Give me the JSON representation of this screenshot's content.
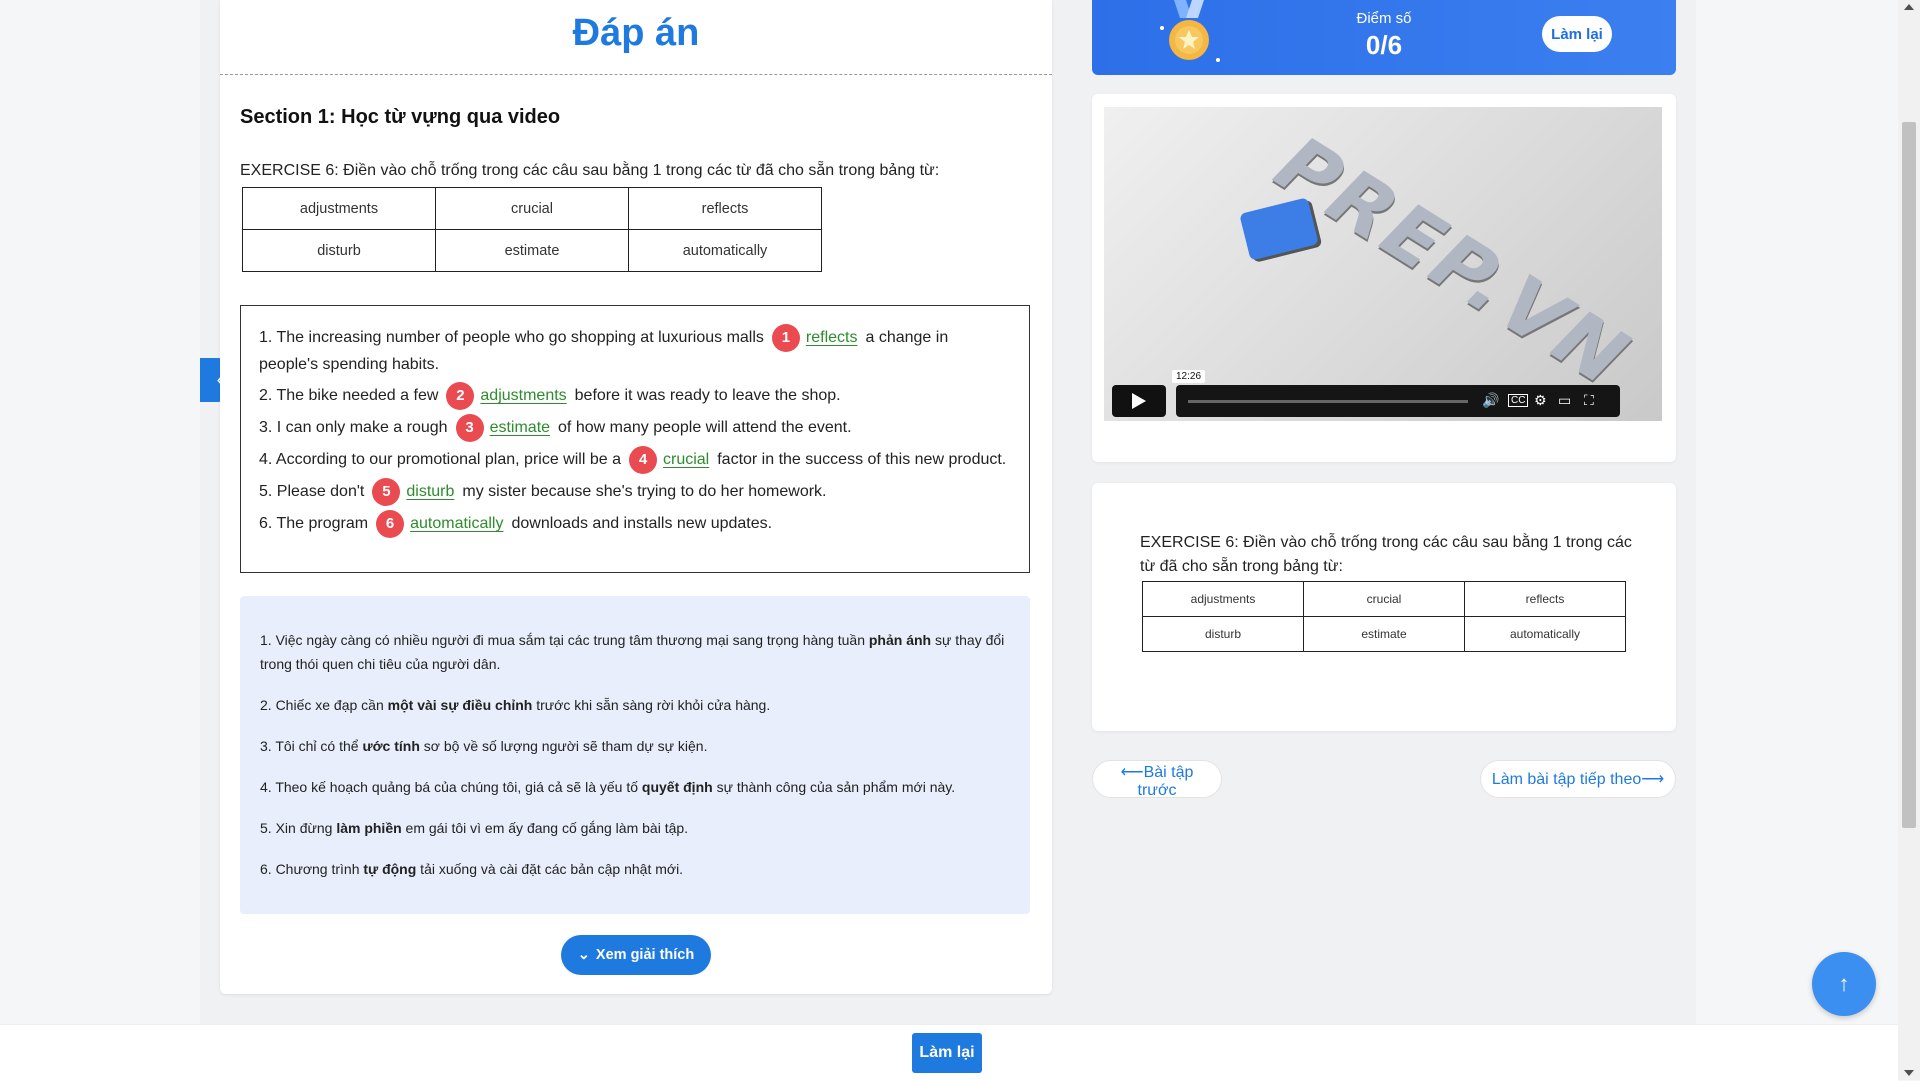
{
  "header": {
    "title": "Đáp án"
  },
  "section": {
    "title": "Section 1: Học từ vựng qua video"
  },
  "exercise": {
    "intro": "EXERCISE 6: Điền vào chỗ trống trong các câu sau bằng 1 trong các từ đã cho sẵn trong bảng từ:",
    "words": [
      [
        "adjustments",
        "crucial",
        "reflects"
      ],
      [
        "disturb",
        "estimate",
        "automatically"
      ]
    ]
  },
  "questions": [
    {
      "num": "1",
      "before": "1. The increasing number of people who go shopping at luxurious malls",
      "answer": "reflects",
      "after": "a change in people's spending habits."
    },
    {
      "num": "2",
      "before": "2. The bike needed a few",
      "answer": "adjustments",
      "after": "before it was ready to leave the shop."
    },
    {
      "num": "3",
      "before": "3. I can only make a rough",
      "answer": "estimate",
      "after": "of how many people will attend the event."
    },
    {
      "num": "4",
      "before": "4. According to our promotional plan, price will be a",
      "answer": "crucial",
      "after": "factor in the success of this new product."
    },
    {
      "num": "5",
      "before": "5. Please don't",
      "answer": "disturb",
      "after": "my sister because she's trying to do her homework."
    },
    {
      "num": "6",
      "before": "6. The program",
      "answer": "automatically",
      "after": "downloads and installs new updates."
    }
  ],
  "translations": [
    {
      "before": "1. Việc ngày càng có nhiều người đi mua sắm tại các trung tâm thương mại sang trọng hàng tuần ",
      "bold": "phản ánh",
      "after": " sự thay đổi trong thói quen chi tiêu của người dân."
    },
    {
      "before": "2. Chiếc xe đạp cần ",
      "bold": "một vài sự điều chỉnh",
      "after": " trước khi sẵn sàng rời khỏi cửa hàng."
    },
    {
      "before": "3. Tôi chỉ có thể ",
      "bold": "ước tính",
      "after": " sơ bộ về số lượng người sẽ tham dự sự kiện."
    },
    {
      "before": "4. Theo kế hoạch quảng bá của chúng tôi, giá cả sẽ là yếu tố ",
      "bold": "quyết định",
      "after": " sự thành công của sản phẩm mới này."
    },
    {
      "before": "5. Xin đừng ",
      "bold": "làm phiền",
      "after": " em gái tôi vì em ấy đang cố gắng làm bài tập."
    },
    {
      "before": "6. Chương trình ",
      "bold": "tự động",
      "after": " tải xuống và cài đặt các bản cập nhật mới."
    }
  ],
  "buttons": {
    "explain": "Xem giải thích",
    "retry": "Làm lại",
    "prev_exercise": "⟵Bài tập trước",
    "next_exercise": "Làm bài tập tiếp theo⟶"
  },
  "score": {
    "label": "Điểm số",
    "value": "0/6"
  },
  "video": {
    "time": "12:26",
    "logo": "PREP.VN"
  },
  "colors": {
    "primary": "#1f7ae0",
    "badge": "#e94b50",
    "answer": "#2e8b2e",
    "translation_bg": "#e8eefb"
  }
}
